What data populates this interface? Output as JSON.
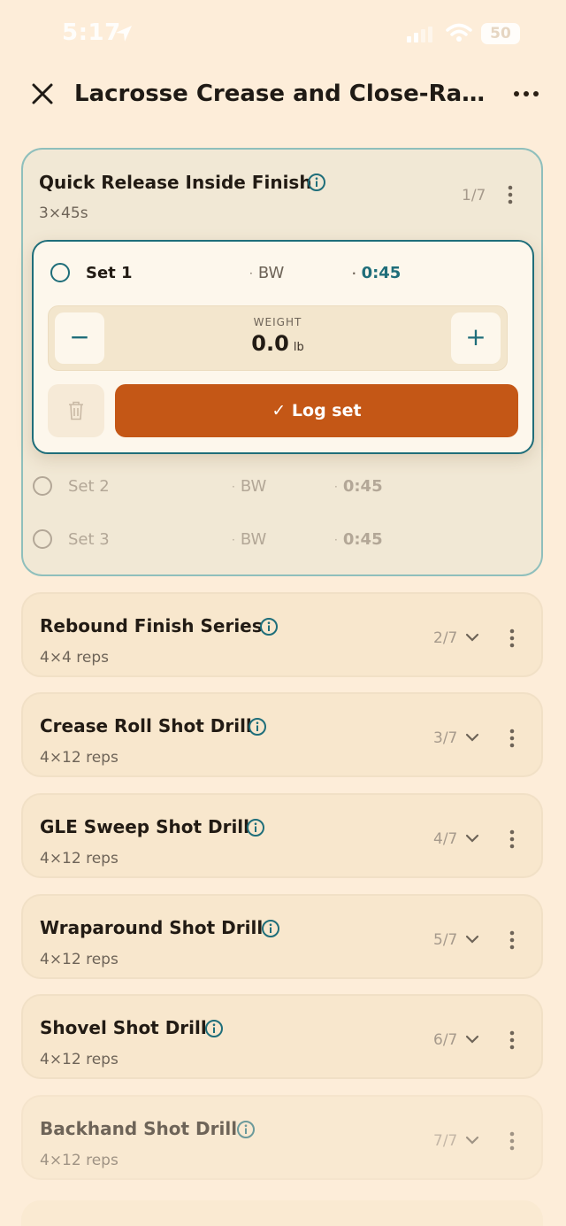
{
  "status_bar": {
    "time": "5:17",
    "battery": "50"
  },
  "header": {
    "title": "Lacrosse Crease and Close-Rang…"
  },
  "active_exercise": {
    "name": "Quick Release Inside Finish",
    "scheme": "3×45s",
    "position": "1/7",
    "current_set": {
      "label": "Set 1",
      "load": "BW",
      "time": "0:45",
      "weight_label": "WEIGHT",
      "weight_value": "0.0",
      "weight_unit": "lb",
      "log_button": "✓ Log set"
    },
    "pending_sets": [
      {
        "label": "Set 2",
        "load": "BW",
        "time": "0:45"
      },
      {
        "label": "Set 3",
        "load": "BW",
        "time": "0:45"
      }
    ]
  },
  "exercises": [
    {
      "name": "Rebound Finish Series",
      "scheme": "4×4 reps",
      "position": "2/7"
    },
    {
      "name": "Crease Roll Shot Drill",
      "scheme": "4×12 reps",
      "position": "3/7"
    },
    {
      "name": "GLE Sweep Shot Drill",
      "scheme": "4×12 reps",
      "position": "4/7"
    },
    {
      "name": "Wraparound Shot Drill",
      "scheme": "4×12 reps",
      "position": "5/7"
    },
    {
      "name": "Shovel Shot Drill",
      "scheme": "4×12 reps",
      "position": "6/7"
    },
    {
      "name": "Backhand Shot Drill",
      "scheme": "4×12 reps",
      "position": "7/7"
    }
  ],
  "colors": {
    "accent": "#1f6e7a",
    "primary_button": "#c45716",
    "background": "#fdedd9"
  }
}
